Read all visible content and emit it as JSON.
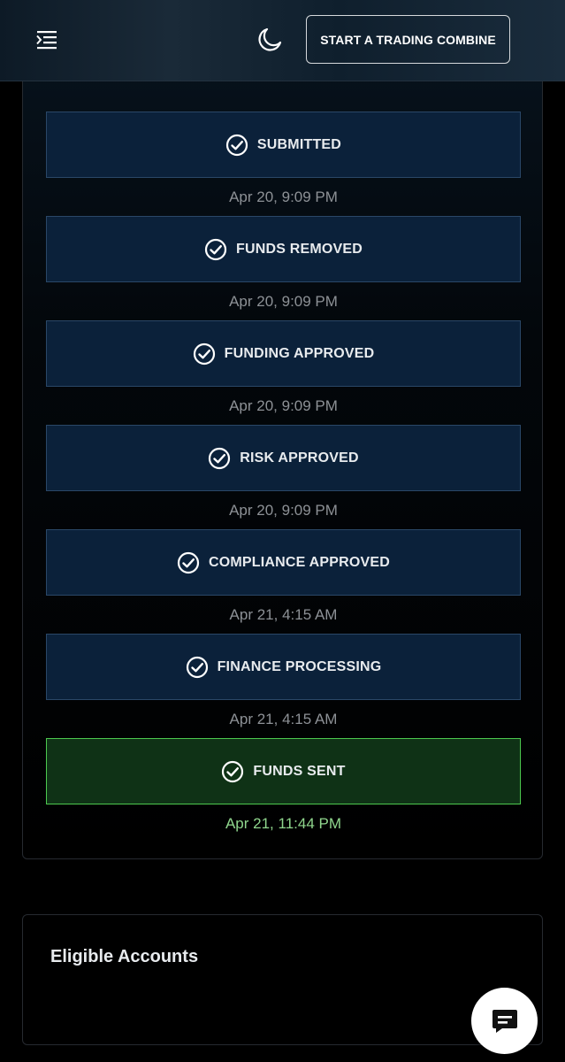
{
  "header": {
    "menu_icon": "sidebar-expand-icon",
    "theme_icon": "moon-icon",
    "start_button_label": "START A TRADING COMBINE"
  },
  "status_steps": [
    {
      "label": "SUBMITTED",
      "time": "Apr 20, 9:09 PM",
      "state": "completed"
    },
    {
      "label": "FUNDS REMOVED",
      "time": "Apr 20, 9:09 PM",
      "state": "completed"
    },
    {
      "label": "FUNDING APPROVED",
      "time": "Apr 20, 9:09 PM",
      "state": "completed"
    },
    {
      "label": "RISK APPROVED",
      "time": "Apr 20, 9:09 PM",
      "state": "completed"
    },
    {
      "label": "COMPLIANCE APPROVED",
      "time": "Apr 21, 4:15 AM",
      "state": "completed"
    },
    {
      "label": "FINANCE PROCESSING",
      "time": "Apr 21, 4:15 AM",
      "state": "completed"
    },
    {
      "label": "FUNDS SENT",
      "time": "Apr 21, 11:44 PM",
      "state": "final"
    }
  ],
  "eligible_accounts": {
    "title": "Eligible Accounts"
  },
  "chat": {
    "icon": "chat-icon"
  },
  "colors": {
    "step_bg": "#0b213a",
    "step_border": "#2a4767",
    "final_bg": "#0f3216",
    "final_border": "#4cc94f",
    "final_time": "#8fd68d",
    "time_text": "#8d9196"
  }
}
